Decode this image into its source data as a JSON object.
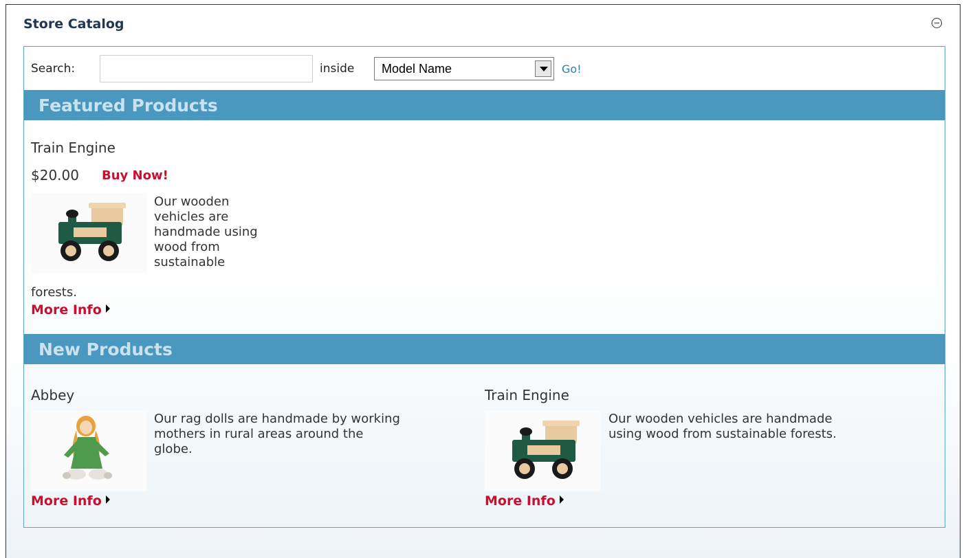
{
  "portlet": {
    "title": "Store Catalog"
  },
  "search": {
    "label": "Search:",
    "value": "",
    "placeholder": "",
    "inside_label": "inside",
    "field_selected": "Model Name",
    "go_label": "Go!"
  },
  "featured": {
    "heading": "Featured Products",
    "product": {
      "name": "Train Engine",
      "price": "$20.00",
      "buy_label": "Buy Now!",
      "desc_lines": [
        "Our wooden",
        "vehicles are",
        "handmade using",
        "wood from",
        "sustainable"
      ],
      "desc_tail": "forests.",
      "image": "wooden-train-engine",
      "more_info": "More Info"
    }
  },
  "new_products": {
    "heading": "New Products",
    "items": [
      {
        "name": "Abbey",
        "desc_lines": [
          "Our rag dolls are handmade by working",
          "mothers in rural areas around the",
          "globe."
        ],
        "image": "rag-doll",
        "more_info": "More Info"
      },
      {
        "name": "Train Engine",
        "desc_lines": [
          "Our wooden vehicles are handmade",
          "using wood from sustainable forests."
        ],
        "image": "wooden-train-engine",
        "more_info": "More Info"
      }
    ]
  },
  "colors": {
    "section_header_bg": "#4a97bf",
    "section_header_text": "#c9e2ef",
    "link_red": "#c8102e",
    "link_blue": "#2c7fb8",
    "box_border": "#5da5c8"
  }
}
